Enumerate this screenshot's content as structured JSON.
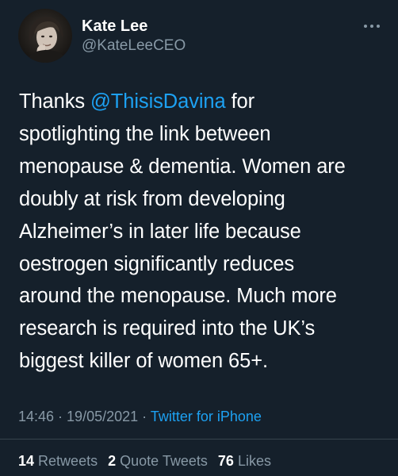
{
  "author": {
    "display_name": "Kate Lee",
    "handle": "@KateLeeCEO"
  },
  "tweet": {
    "lines": [
      {
        "prefix": "Thanks ",
        "mention": "@ThisisDavina",
        "suffix": " for"
      },
      "spotlighting the link between",
      "menopause & dementia. Women are",
      "doubly at risk from developing",
      "Alzheimer’s in later life because",
      "oestrogen significantly reduces",
      "around the menopause. Much more",
      "research is required into the UK’s",
      "biggest killer of women 65+."
    ]
  },
  "meta": {
    "time": "14:46",
    "separator1": " · ",
    "date": "19/05/2021",
    "separator2": " · ",
    "source": "Twitter for iPhone"
  },
  "stats": {
    "retweets_count": "14",
    "retweets_label": "Retweets",
    "quote_count": "2",
    "quote_label": "Quote Tweets",
    "likes_count": "76",
    "likes_label": "Likes"
  },
  "icons": {
    "more": "more-horizontal-icon",
    "avatar": "avatar"
  },
  "colors": {
    "background": "#15202b",
    "text_primary": "#ffffff",
    "text_secondary": "#8899a6",
    "accent": "#1da1f2",
    "divider": "#38444d"
  }
}
